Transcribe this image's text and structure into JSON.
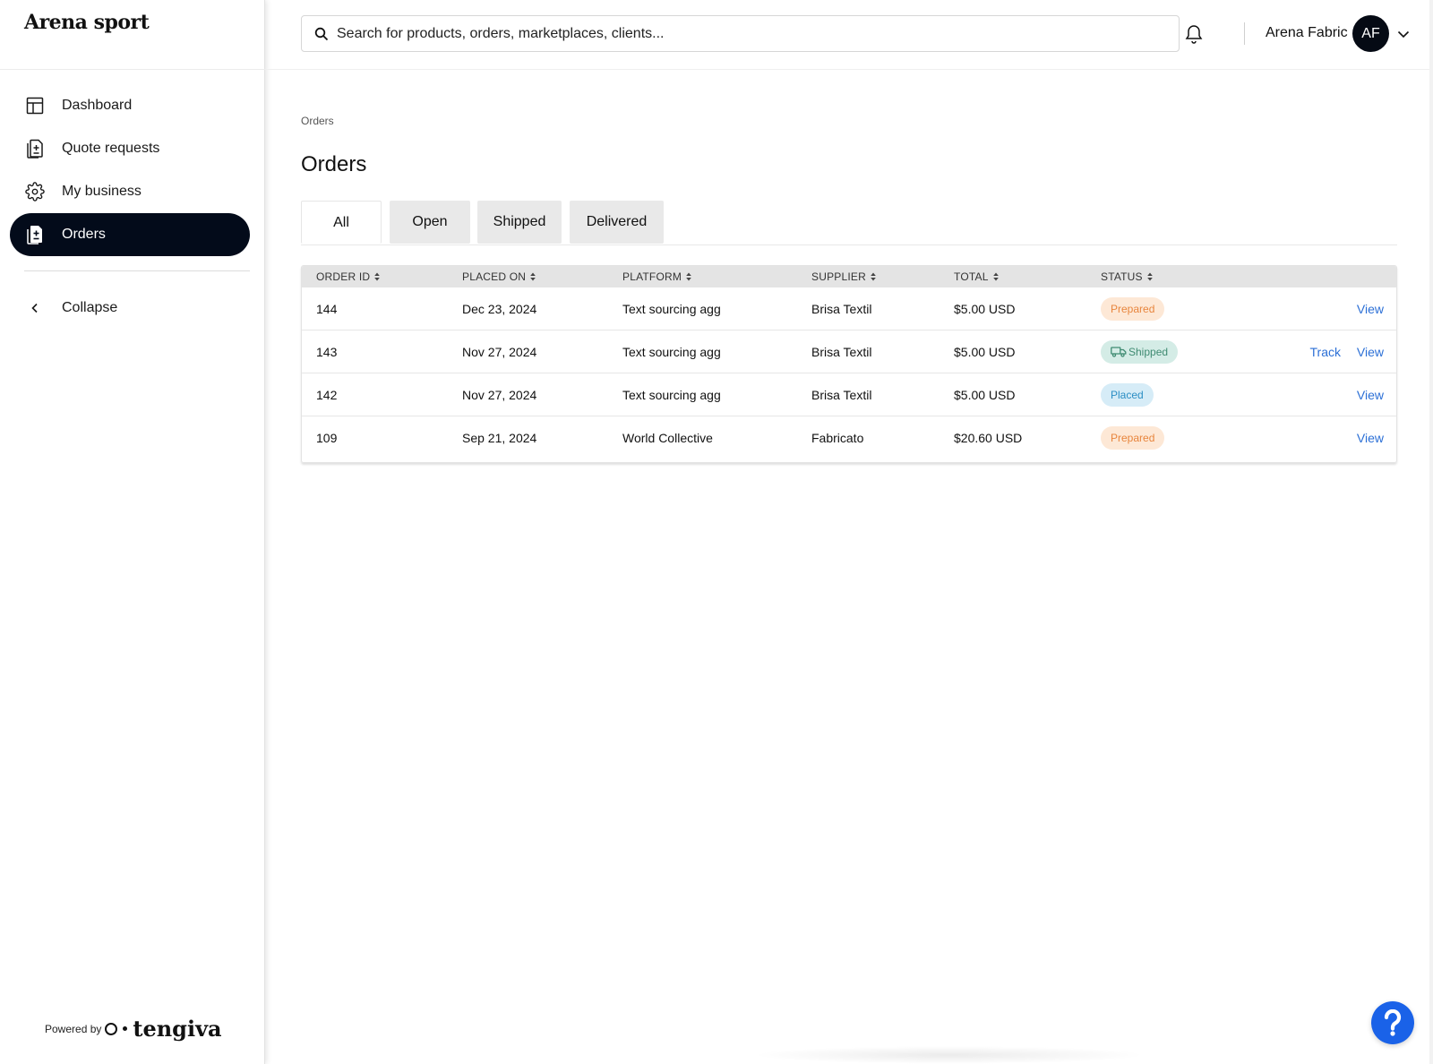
{
  "brand": "Arena sport",
  "sidebar": {
    "items": [
      {
        "label": "Dashboard",
        "icon": "dashboard-icon",
        "active": false
      },
      {
        "label": "Quote requests",
        "icon": "quote-icon",
        "active": false
      },
      {
        "label": "My business",
        "icon": "gear-icon",
        "active": false
      },
      {
        "label": "Orders",
        "icon": "orders-icon",
        "active": true
      }
    ],
    "collapse_label": "Collapse",
    "powered_by": "Powered by",
    "powered_logo": "tengiva"
  },
  "header": {
    "search_placeholder": "Search for products, orders, marketplaces, clients...",
    "user_name": "Arena Fabric",
    "avatar_initials": "AF"
  },
  "main": {
    "breadcrumb": "Orders",
    "title": "Orders",
    "tabs": [
      {
        "label": "All",
        "active": true
      },
      {
        "label": "Open",
        "active": false
      },
      {
        "label": "Shipped",
        "active": false
      },
      {
        "label": "Delivered",
        "active": false
      }
    ],
    "table": {
      "columns": [
        "ORDER ID",
        "PLACED ON",
        "PLATFORM",
        "SUPPLIER",
        "TOTAL",
        "STATUS"
      ],
      "rows": [
        {
          "id": "144",
          "placed_on": "Dec 23, 2024",
          "platform": "Text sourcing agg",
          "supplier": "Brisa Textil",
          "total": "$5.00 USD",
          "status": "Prepared",
          "track": "",
          "view": "View"
        },
        {
          "id": "143",
          "placed_on": "Nov 27, 2024",
          "platform": "Text sourcing agg",
          "supplier": "Brisa Textil",
          "total": "$5.00 USD",
          "status": "Shipped",
          "track": "Track",
          "view": "View"
        },
        {
          "id": "142",
          "placed_on": "Nov 27, 2024",
          "platform": "Text sourcing agg",
          "supplier": "Brisa Textil",
          "total": "$5.00 USD",
          "status": "Placed",
          "track": "",
          "view": "View"
        },
        {
          "id": "109",
          "placed_on": "Sep 21, 2024",
          "platform": "World Collective",
          "supplier": "Fabricato",
          "total": "$20.60 USD",
          "status": "Prepared",
          "track": "",
          "view": "View"
        }
      ]
    }
  },
  "colors": {
    "active_nav_bg": "#030b1a",
    "link": "#2b6fd6",
    "help_button": "#1a62e8",
    "status_prepared": "#e8853d",
    "status_shipped": "#3f8b72",
    "status_placed": "#2b8ec4"
  }
}
